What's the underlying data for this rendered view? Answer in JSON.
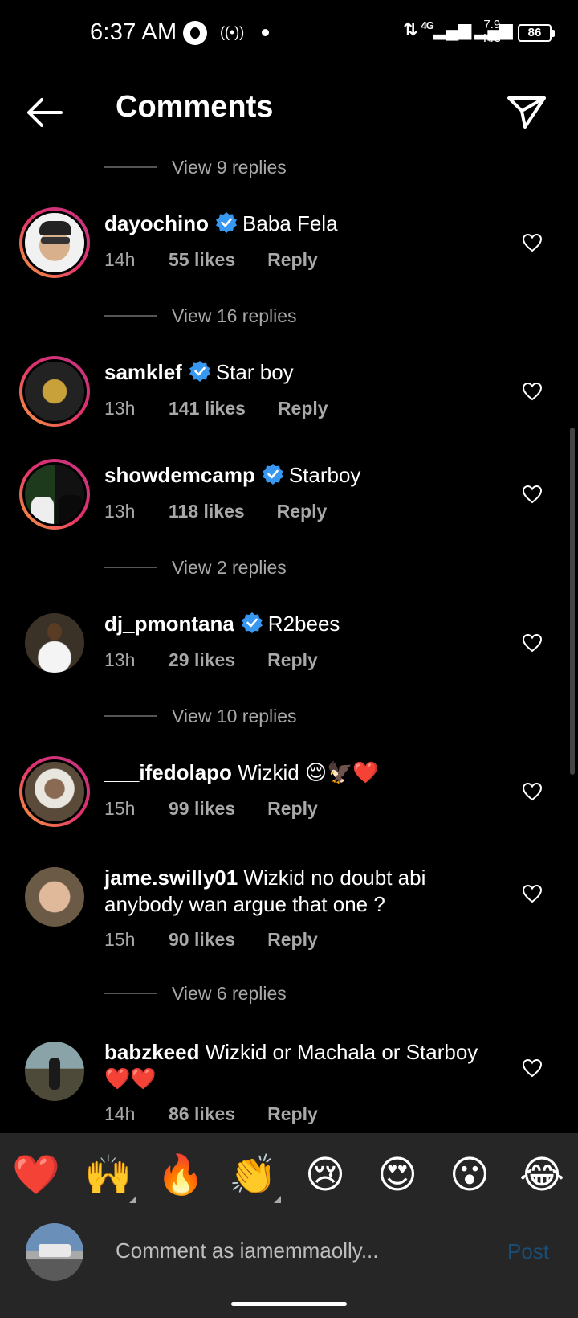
{
  "status_bar": {
    "time": "6:37 AM",
    "network": "4G",
    "speed_value": "7.9",
    "speed_unit": "K/s",
    "battery": "86"
  },
  "header": {
    "title": "Comments",
    "back_icon": "arrow-left-icon",
    "send_icon": "paper-plane-icon"
  },
  "view_replies": [
    {
      "label": "View 9 replies"
    },
    {
      "label": "View 16 replies"
    },
    {
      "label": "View 2 replies"
    },
    {
      "label": "View 10 replies"
    },
    {
      "label": "View 6 replies"
    }
  ],
  "comments": [
    {
      "username": "dayochino",
      "verified": true,
      "text": "Baba Fela",
      "time": "14h",
      "likes": "55 likes",
      "reply": "Reply"
    },
    {
      "username": "samklef",
      "verified": true,
      "text": "Star boy",
      "time": "13h",
      "likes": "141 likes",
      "reply": "Reply"
    },
    {
      "username": "showdemcamp",
      "verified": true,
      "text": "Starboy",
      "time": "13h",
      "likes": "118 likes",
      "reply": "Reply"
    },
    {
      "username": "dj_pmontana",
      "verified": true,
      "text": "R2bees",
      "time": "13h",
      "likes": "29 likes",
      "reply": "Reply"
    },
    {
      "username": "___ifedolapo",
      "verified": false,
      "text": "Wizkid 😌🦅❤️",
      "time": "15h",
      "likes": "99 likes",
      "reply": "Reply"
    },
    {
      "username": "jame.swilly01",
      "verified": false,
      "text": "Wizkid no doubt abi anybody wan argue  that one ?",
      "time": "15h",
      "likes": "90 likes",
      "reply": "Reply"
    },
    {
      "username": "babzkeed",
      "verified": false,
      "text": "Wizkid or Machala or Starboy ❤️❤️",
      "time": "14h",
      "likes": "86 likes",
      "reply": "Reply"
    }
  ],
  "emoji_bar": [
    "❤️",
    "🙌",
    "🔥",
    "👏",
    "😢",
    "😍",
    "😮",
    "😂"
  ],
  "composer": {
    "placeholder": "Comment as iamemmaolly...",
    "post_label": "Post"
  },
  "colors": {
    "background": "#000000",
    "verified": "#3897f0",
    "secondary_text": "#a8a8a8",
    "post_disabled": "#1a4d73",
    "panel": "#262626"
  }
}
